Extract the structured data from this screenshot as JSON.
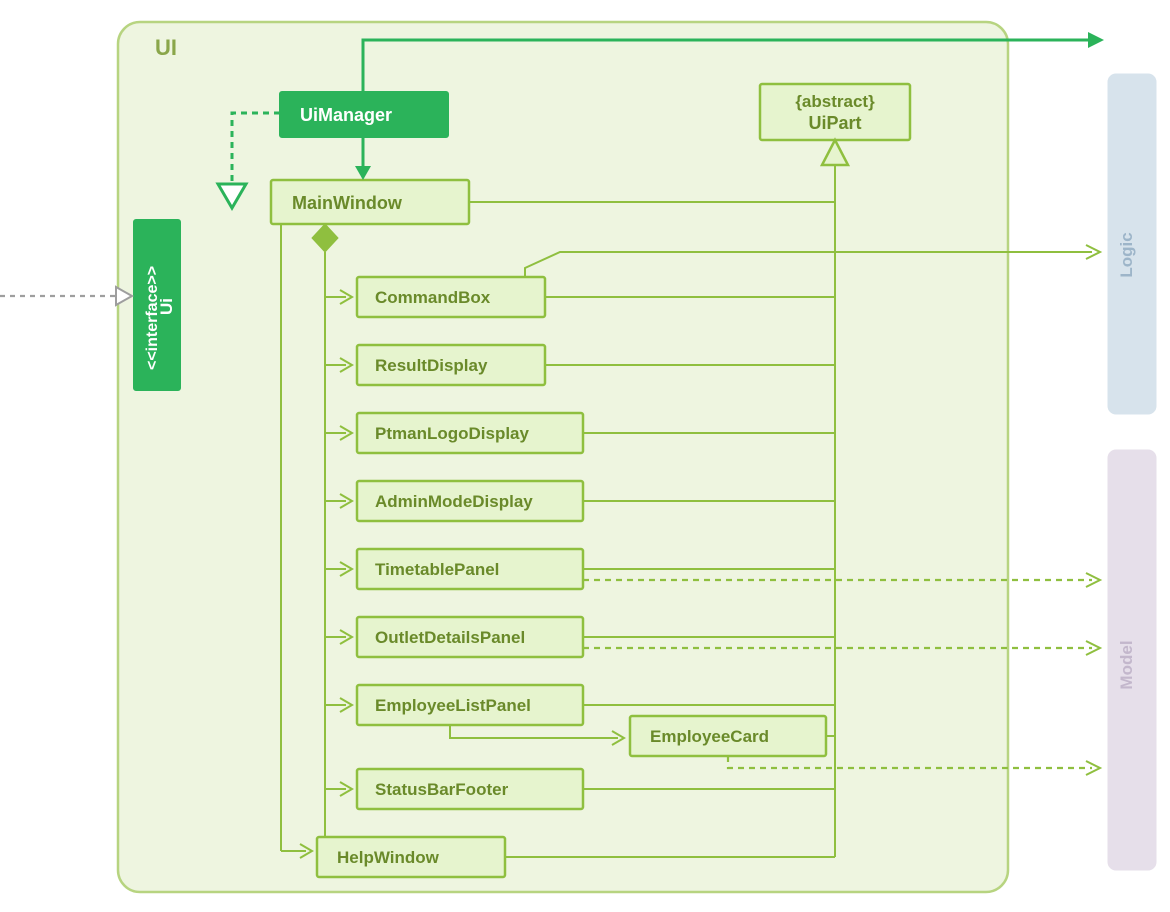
{
  "package": {
    "title": "UI"
  },
  "classes": {
    "uiManager": "UiManager",
    "uiInterface": {
      "stereotype": "<<interface>>",
      "name": "Ui"
    },
    "mainWindow": "MainWindow",
    "uiPart": {
      "stereotype": "{abstract}",
      "name": "UiPart"
    },
    "commandBox": "CommandBox",
    "resultDisplay": "ResultDisplay",
    "ptmanLogoDisplay": "PtmanLogoDisplay",
    "adminModeDisplay": "AdminModeDisplay",
    "timetablePanel": "TimetablePanel",
    "outletDetailsPanel": "OutletDetailsPanel",
    "employeeListPanel": "EmployeeListPanel",
    "employeeCard": "EmployeeCard",
    "statusBarFooter": "StatusBarFooter",
    "helpWindow": "HelpWindow"
  },
  "external": {
    "logic": "Logic",
    "model": "Model"
  }
}
